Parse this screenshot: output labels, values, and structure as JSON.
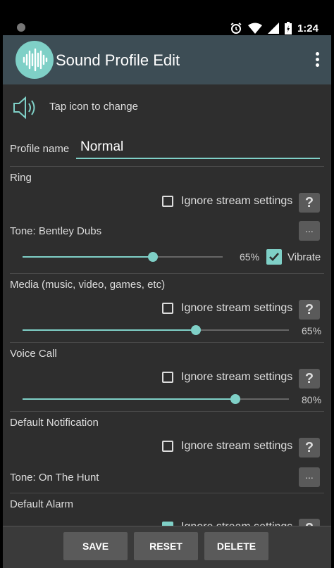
{
  "status": {
    "time": "1:24"
  },
  "appbar": {
    "title": "Sound Profile Edit"
  },
  "header": {
    "tap_label": "Tap icon to change"
  },
  "profile": {
    "name_label": "Profile name",
    "name_value": "Normal"
  },
  "common": {
    "ignore_label": "Ignore stream settings",
    "help": "?",
    "dots": "..."
  },
  "ring": {
    "title": "Ring",
    "tone": "Tone: Bentley Dubs",
    "volume_pct": "65%",
    "volume": 0.65,
    "vibrate_label": "Vibrate",
    "vibrate_checked": true,
    "ignore_checked": false
  },
  "media": {
    "title": "Media (music, video, games, etc)",
    "volume_pct": "65%",
    "volume": 0.65,
    "ignore_checked": false
  },
  "voice": {
    "title": "Voice Call",
    "volume_pct": "80%",
    "volume": 0.8,
    "ignore_checked": false
  },
  "notification": {
    "title": "Default Notification",
    "tone": "Tone: On The Hunt",
    "ignore_checked": false
  },
  "alarm": {
    "title": "Default Alarm",
    "ignore_checked": true
  },
  "buttons": {
    "save": "SAVE",
    "reset": "RESET",
    "delete": "DELETE"
  },
  "colors": {
    "accent": "#7fd0c7",
    "appbar": "#3d4d55",
    "background": "#2e2e2e"
  }
}
